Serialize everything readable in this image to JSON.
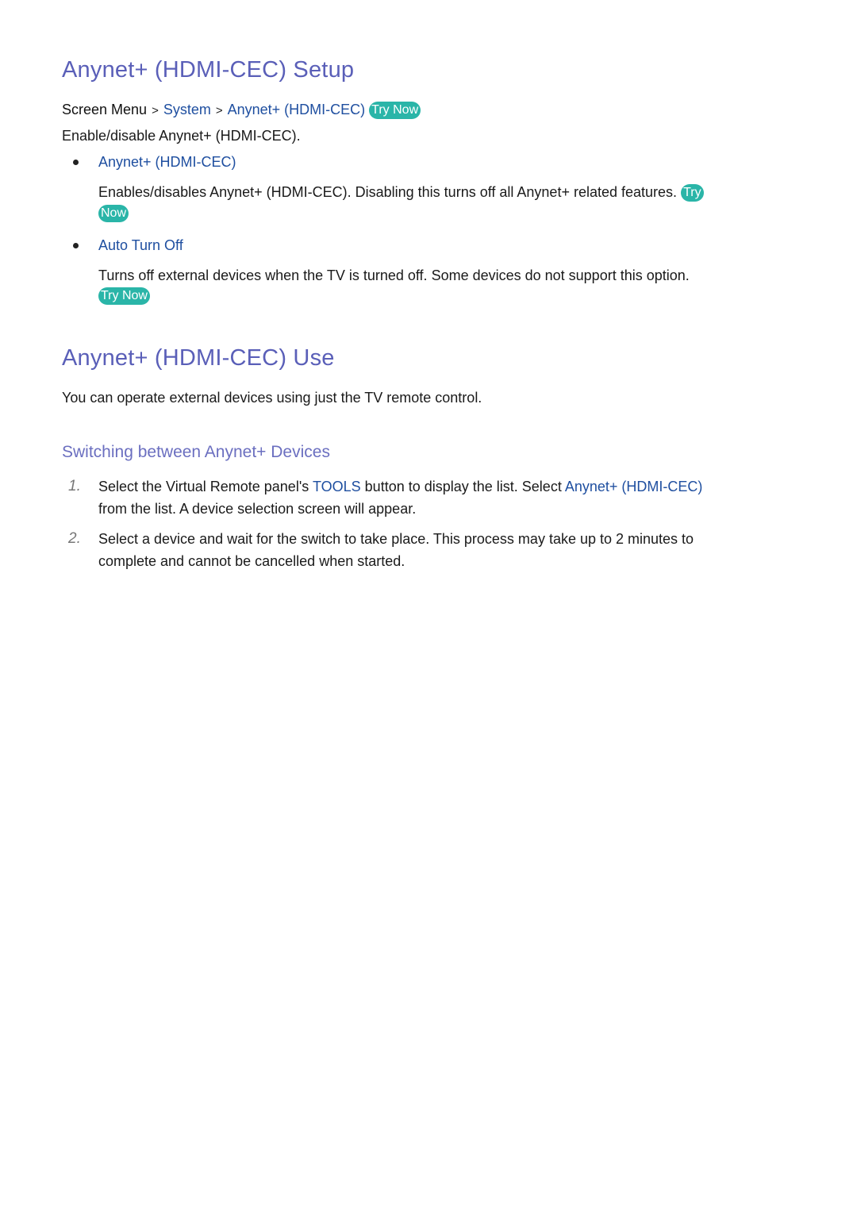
{
  "section1": {
    "title": "Anynet+ (HDMI-CEC) Setup",
    "breadcrumb": {
      "root": "Screen Menu",
      "separator": ">",
      "level1": "System",
      "level2": "Anynet+ (HDMI-CEC)",
      "try_now": "Try Now"
    },
    "description": "Enable/disable Anynet+ (HDMI-CEC).",
    "items": [
      {
        "label": "Anynet+ (HDMI-CEC)",
        "text_line1": "Enables/disables Anynet+ (HDMI-CEC). Disabling this turns off all Anynet+ related features.",
        "try_part1": "Try",
        "try_part2": "Now"
      },
      {
        "label": "Auto Turn Off",
        "text_line1": "Turns off external devices when the TV is turned off. Some devices do not support this option.",
        "try_now": "Try Now"
      }
    ]
  },
  "section2": {
    "title": "Anynet+ (HDMI-CEC) Use",
    "description": "You can operate external devices using just the TV remote control.",
    "subsection": {
      "title": "Switching between Anynet+ Devices",
      "steps": [
        {
          "number": "1.",
          "line1_pre": "Select the Virtual Remote panel's",
          "line1_tools": "TOOLS",
          "line1_mid": "button to display the list. Select",
          "line1_link": "Anynet+ (HDMI-CEC)",
          "line2": "from the list. A device selection screen will appear."
        },
        {
          "number": "2.",
          "line1": "Select a device and wait for the switch to take place. This process may take up to 2 minutes to",
          "line2": "complete and cannot be cancelled when started."
        }
      ]
    }
  }
}
